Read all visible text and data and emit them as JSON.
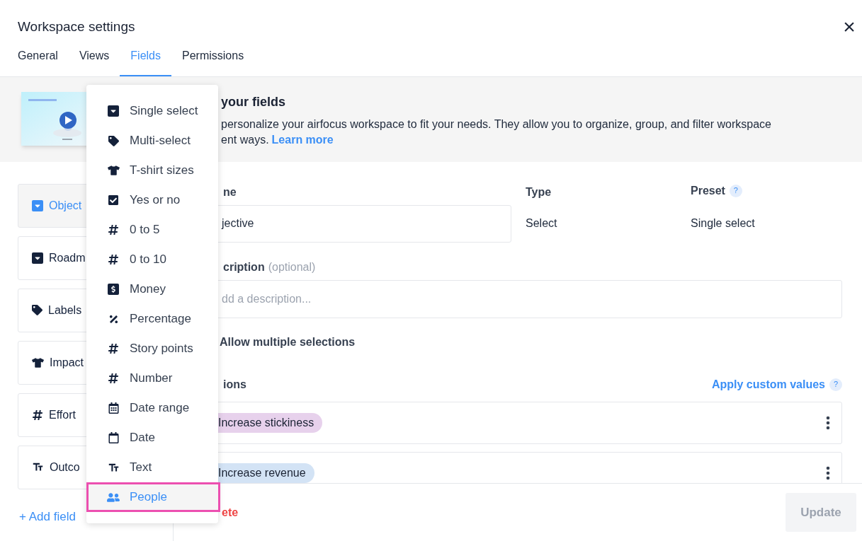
{
  "window": {
    "title": "Workspace settings",
    "close": "×"
  },
  "tabs": [
    {
      "label": "General",
      "selected": false
    },
    {
      "label": "Views",
      "selected": false
    },
    {
      "label": "Fields",
      "selected": true
    },
    {
      "label": "Permissions",
      "selected": false
    }
  ],
  "banner": {
    "title": "your fields",
    "line_1": "personalize your airfocus workspace to fit your needs. They allow you to organize, group, and filter workspace",
    "line_2": "ent ways.",
    "link": "Learn more"
  },
  "sidebar": {
    "items": [
      {
        "label": "Object",
        "kind": "select",
        "selected": true
      },
      {
        "label": "Roadm",
        "kind": "select",
        "selected": false
      },
      {
        "label": "Labels",
        "kind": "tag",
        "selected": false
      },
      {
        "label": "Impact",
        "kind": "tshirt",
        "selected": false
      },
      {
        "label": "Effort",
        "kind": "number",
        "selected": false
      },
      {
        "label": "Outco",
        "kind": "text",
        "selected": false
      }
    ],
    "add": "+ Add field"
  },
  "form": {
    "name_label": "ne",
    "name_value": "jective",
    "type_label": "Type",
    "type_value": "Select",
    "preset_label": "Preset",
    "preset_help": "?",
    "preset_value": "Single select",
    "description_label": "cription",
    "description_optional": "(optional)",
    "description_placeholder": "dd a description...",
    "allow_multiple": "Allow multiple selections",
    "options_label": "ions",
    "apply_custom": "Apply custom values",
    "apply_help": "?",
    "options": [
      {
        "label": "Increase stickiness",
        "color": "#e7d1ec"
      },
      {
        "label": "Increase revenue",
        "color": "#d3e3f5"
      }
    ]
  },
  "footer": {
    "delete": "ete",
    "update": "Update"
  },
  "menu": {
    "items": [
      {
        "label": "Single select",
        "kind": "select",
        "selected": false
      },
      {
        "label": "Multi-select",
        "kind": "tag",
        "selected": false
      },
      {
        "label": "T-shirt sizes",
        "kind": "tshirt",
        "selected": false
      },
      {
        "label": "Yes or no",
        "kind": "check",
        "selected": false
      },
      {
        "label": "0 to 5",
        "kind": "number",
        "selected": false
      },
      {
        "label": "0 to 10",
        "kind": "number",
        "selected": false
      },
      {
        "label": "Money",
        "kind": "money",
        "selected": false
      },
      {
        "label": "Percentage",
        "kind": "percent",
        "selected": false
      },
      {
        "label": "Story points",
        "kind": "number",
        "selected": false
      },
      {
        "label": "Number",
        "kind": "number",
        "selected": false
      },
      {
        "label": "Date range",
        "kind": "daterange",
        "selected": false
      },
      {
        "label": "Date",
        "kind": "date",
        "selected": false
      },
      {
        "label": "Text",
        "kind": "text",
        "selected": false
      },
      {
        "label": "People",
        "kind": "people",
        "selected": true
      }
    ]
  }
}
